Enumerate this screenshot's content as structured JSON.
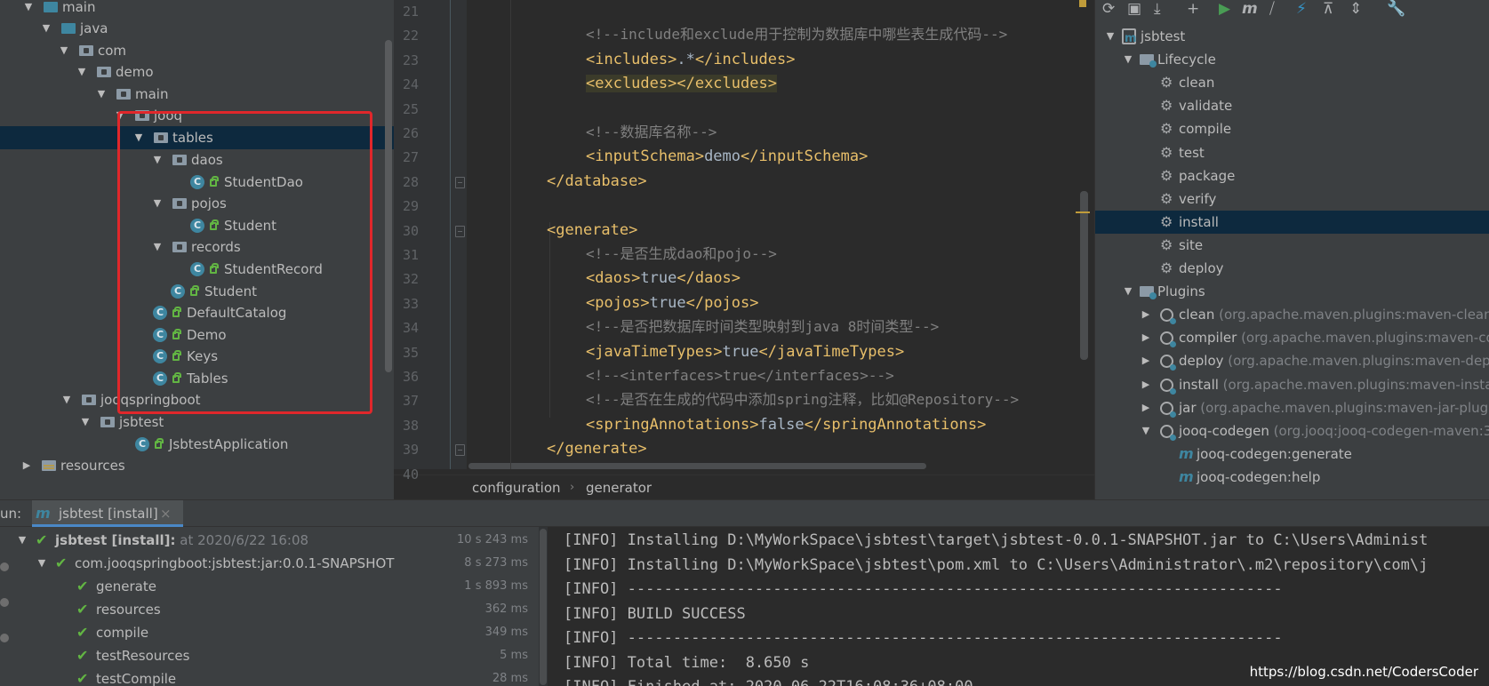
{
  "project_tree": {
    "items": [
      {
        "label": "main",
        "arrow": "▼",
        "icon": "src"
      },
      {
        "label": "java",
        "arrow": "▼",
        "icon": "src"
      },
      {
        "label": "com",
        "arrow": "▼",
        "icon": "pkg"
      },
      {
        "label": "demo",
        "arrow": "▼",
        "icon": "pkg"
      },
      {
        "label": "main",
        "arrow": "▼",
        "icon": "pkg"
      },
      {
        "label": "jooq",
        "arrow": "▼",
        "icon": "pkg"
      },
      {
        "label": "tables",
        "arrow": "▼",
        "icon": "pkg",
        "selected": true
      },
      {
        "label": "daos",
        "arrow": "▼",
        "icon": "pkg"
      },
      {
        "label": "StudentDao",
        "icon": "class"
      },
      {
        "label": "pojos",
        "arrow": "▼",
        "icon": "pkg"
      },
      {
        "label": "Student",
        "icon": "class"
      },
      {
        "label": "records",
        "arrow": "▼",
        "icon": "pkg"
      },
      {
        "label": "StudentRecord",
        "icon": "class"
      },
      {
        "label": "Student",
        "icon": "class"
      },
      {
        "label": "DefaultCatalog",
        "icon": "class"
      },
      {
        "label": "Demo",
        "icon": "class"
      },
      {
        "label": "Keys",
        "icon": "class"
      },
      {
        "label": "Tables",
        "icon": "class"
      },
      {
        "label": "jooqspringboot",
        "arrow": "▼",
        "icon": "pkg"
      },
      {
        "label": "jsbtest",
        "arrow": "▼",
        "icon": "pkg"
      },
      {
        "label": "JsbtestApplication",
        "icon": "springclass"
      },
      {
        "label": "resources",
        "arrow": "▶",
        "icon": "res"
      }
    ]
  },
  "editor": {
    "line_numbers": [
      "21",
      "22",
      "23",
      "24",
      "25",
      "26",
      "27",
      "28",
      "29",
      "30",
      "31",
      "32",
      "33",
      "34",
      "35",
      "36",
      "37",
      "38",
      "39",
      "40"
    ],
    "lines": {
      "l22": {
        "text": "<!--include和exclude用于控制为数据库中哪些表生成代码-->"
      },
      "l23": {
        "open": "<includes>",
        "value": ".*",
        "close": "</includes>"
      },
      "l24": {
        "open": "<excludes>",
        "close": "</excludes>"
      },
      "l26": {
        "text": "<!--数据库名称-->"
      },
      "l27": {
        "open": "<inputSchema>",
        "value": "demo",
        "close": "</inputSchema>"
      },
      "l28": {
        "close": "</database>"
      },
      "l30": {
        "open": "<generate>"
      },
      "l31": {
        "text": "<!--是否生成dao和pojo-->"
      },
      "l32": {
        "open": "<daos>",
        "value": "true",
        "close": "</daos>"
      },
      "l33": {
        "open": "<pojos>",
        "value": "true",
        "close": "</pojos>"
      },
      "l34": {
        "text": "<!--是否把数据库时间类型映射到java 8时间类型-->"
      },
      "l35": {
        "open": "<javaTimeTypes>",
        "value": "true",
        "close": "</javaTimeTypes>"
      },
      "l36": {
        "text": "<!--<interfaces>true</interfaces>-->"
      },
      "l37": {
        "text": "<!--是否在生成的代码中添加spring注释，比如@Repository-->"
      },
      "l38": {
        "open": "<springAnnotations>",
        "value": "false",
        "close": "</springAnnotations>"
      },
      "l39": {
        "close": "</generate>"
      }
    },
    "breadcrumb": [
      "configuration",
      "generator"
    ],
    "breadcrumb_sep": "›"
  },
  "maven": {
    "toolbar_icons": [
      {
        "name": "reload-icon",
        "glyph": "⟳"
      },
      {
        "name": "generate-sources-icon",
        "glyph": "▣"
      },
      {
        "name": "download-icon",
        "glyph": "⤓"
      },
      {
        "name": "add-icon",
        "glyph": "+"
      },
      {
        "name": "run-icon",
        "glyph": "▶"
      },
      {
        "name": "maven-goal-icon",
        "glyph": "m"
      },
      {
        "name": "toggle-offline-icon",
        "glyph": "⧸"
      },
      {
        "name": "skip-tests-icon",
        "glyph": "⚡"
      },
      {
        "name": "show-dependencies-icon",
        "glyph": "⊼"
      },
      {
        "name": "collapse-all-icon",
        "glyph": "⇕"
      },
      {
        "name": "settings-wrench-icon",
        "glyph": "🔧"
      }
    ],
    "project": "jsbtest",
    "lifecycle_label": "Lifecycle",
    "lifecycle": [
      "clean",
      "validate",
      "compile",
      "test",
      "package",
      "verify",
      "install",
      "site",
      "deploy"
    ],
    "selected_goal": "install",
    "plugins_label": "Plugins",
    "plugins": [
      {
        "name": "clean",
        "desc": "(org.apache.maven.plugins:maven-clean-p"
      },
      {
        "name": "compiler",
        "desc": "(org.apache.maven.plugins:maven-com"
      },
      {
        "name": "deploy",
        "desc": "(org.apache.maven.plugins:maven-deplo"
      },
      {
        "name": "install",
        "desc": "(org.apache.maven.plugins:maven-install-"
      },
      {
        "name": "jar",
        "desc": "(org.apache.maven.plugins:maven-jar-plugin:"
      },
      {
        "name": "jooq-codegen",
        "desc": "(org.jooq:jooq-codegen-maven:3"
      }
    ],
    "jooq_goals": [
      "jooq-codegen:generate",
      "jooq-codegen:help"
    ]
  },
  "run": {
    "label": "un:",
    "tab_title": "jsbtest [install]",
    "tab_close": "×",
    "tree": [
      {
        "label": "jsbtest [install]:",
        "meta": "at 2020/6/22 16:08",
        "time": "10 s 243 ms",
        "level": 0,
        "bold": true
      },
      {
        "label": "com.jooqspringboot:jsbtest:jar:0.0.1-SNAPSHOT",
        "time": "8 s 273 ms",
        "level": 1
      },
      {
        "label": "generate",
        "time": "1 s 893 ms",
        "level": 2
      },
      {
        "label": "resources",
        "time": "362 ms",
        "level": 2
      },
      {
        "label": "compile",
        "time": "349 ms",
        "level": 2
      },
      {
        "label": "testResources",
        "time": "5 ms",
        "level": 2
      },
      {
        "label": "testCompile",
        "time": "28 ms",
        "level": 2
      }
    ],
    "console": [
      "[INFO] Installing D:\\MyWorkSpace\\jsbtest\\target\\jsbtest-0.0.1-SNAPSHOT.jar to C:\\Users\\Administ",
      "[INFO] Installing D:\\MyWorkSpace\\jsbtest\\pom.xml to C:\\Users\\Administrator\\.m2\\repository\\com\\j",
      "[INFO] ------------------------------------------------------------------------",
      "[INFO] BUILD SUCCESS",
      "[INFO] ------------------------------------------------------------------------",
      "[INFO] Total time:  8.650 s",
      "[INFO] Finished at: 2020-06-22T16:08:36+08:00"
    ],
    "watermark": "https://blog.csdn.net/CodersCoder"
  },
  "colors": {
    "tag": "#e8bf6a",
    "text": "#a9b7c6",
    "comment": "#808080",
    "success": "#62b543",
    "highlight_box": "#e0272b",
    "selection": "#0d293e"
  }
}
